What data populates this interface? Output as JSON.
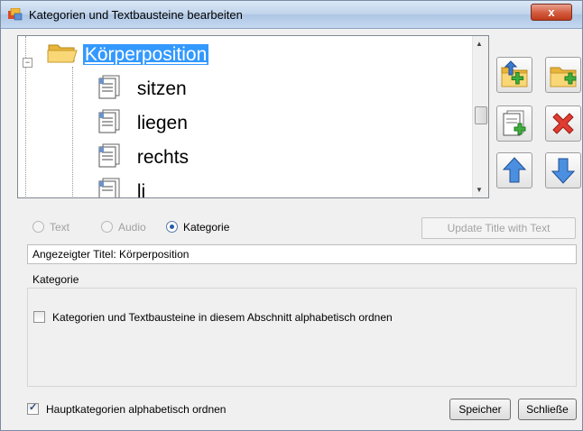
{
  "window": {
    "title": "Kategorien und Textbausteine bearbeiten",
    "close_label": "x"
  },
  "tree": {
    "root": {
      "label": "Körperposition",
      "expander": "−"
    },
    "children": [
      {
        "label": "sitzen"
      },
      {
        "label": "liegen"
      },
      {
        "label": "rechts"
      },
      {
        "label": "li"
      }
    ]
  },
  "toolbar": {
    "icons": [
      "folder-up-icon",
      "add-folder-icon",
      "add-document-icon",
      "delete-icon",
      "move-up-icon",
      "move-down-icon"
    ],
    "colors": {
      "folder": "#f2c94c",
      "plus": "#3fae3f",
      "delete": "#e03c31",
      "arrow": "#3b7bd1"
    }
  },
  "type_options": {
    "text": "Text",
    "audio": "Audio",
    "category": "Kategorie",
    "selected": "Kategorie"
  },
  "update_button": "Update Title with Text",
  "displayed_title": "Angezeigter Titel: Körperposition",
  "category_group": {
    "label": "Kategorie",
    "sort_section_label": "Kategorien und Textbausteine in diesem Abschnitt alphabetisch ordnen",
    "sort_section_checked": false
  },
  "footer": {
    "sort_main_label": "Hauptkategorien alphabetisch ordnen",
    "sort_main_checked": true,
    "save_label": "Speicher",
    "close_label": "Schließe"
  }
}
